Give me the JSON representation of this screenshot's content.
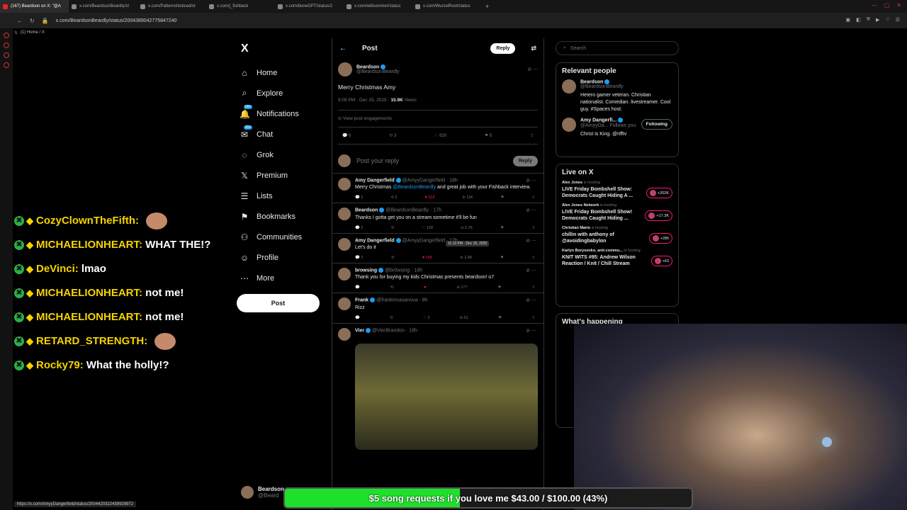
{
  "browser": {
    "tabs": [
      {
        "label": "(167) Beardson on X: \"@A",
        "active": true
      },
      {
        "label": "x.com/BeardsonBeardly/st",
        "active": false
      },
      {
        "label": "x.com/PatternsNoticed/st",
        "active": false
      },
      {
        "label": "x.com/j_fishback",
        "active": false
      },
      {
        "label": "x.com/boneGPT/status/2",
        "active": false
      },
      {
        "label": "x.com/willsommer/status",
        "active": false
      },
      {
        "label": "x.com/WurzelRoot/status",
        "active": false
      }
    ],
    "url": "x.com/BeardsonBeardly/status/2004389042775847240",
    "bookmark": "(1) Home / X",
    "status_url": "https://x.com/AmyyDangerfield/status/2004420322439929972"
  },
  "chat": [
    {
      "name": "CozyClownTheFifth:",
      "text": "",
      "emote": true
    },
    {
      "name": "MICHAELIONHEART:",
      "text": "WHAT THE!?",
      "emote": false
    },
    {
      "name": "DeVinci:",
      "text": "lmao",
      "emote": false
    },
    {
      "name": "MICHAELIONHEART:",
      "text": "not me!",
      "emote": false
    },
    {
      "name": "MICHAELIONHEART:",
      "text": "not me!",
      "emote": false
    },
    {
      "name": "RETARD_STRENGTH:",
      "text": "",
      "emote": true
    },
    {
      "name": "Rocky79:",
      "text": "What the holly!?",
      "emote": false
    }
  ],
  "xnav": {
    "logo": "X",
    "items": [
      {
        "label": "Home",
        "icon": "⌂",
        "badge": ""
      },
      {
        "label": "Explore",
        "icon": "⌕",
        "badge": ""
      },
      {
        "label": "Notifications",
        "icon": "🔔",
        "badge": "99+"
      },
      {
        "label": "Chat",
        "icon": "✉",
        "badge": "20+"
      },
      {
        "label": "Grok",
        "icon": "◌",
        "badge": ""
      },
      {
        "label": "Premium",
        "icon": "𝕏",
        "badge": ""
      },
      {
        "label": "Lists",
        "icon": "☰",
        "badge": ""
      },
      {
        "label": "Bookmarks",
        "icon": "⚑",
        "badge": ""
      },
      {
        "label": "Communities",
        "icon": "⚇",
        "badge": ""
      },
      {
        "label": "Profile",
        "icon": "☺",
        "badge": ""
      },
      {
        "label": "More",
        "icon": "⋯",
        "badge": ""
      }
    ],
    "post_label": "Post",
    "account_name": "Beardson",
    "account_handle": "@Beard"
  },
  "main": {
    "title": "Post",
    "reply_label": "Reply",
    "op": {
      "name": "Beardson",
      "handle": "@BeardsonBeardly",
      "text": "Merry Christmas Amy",
      "meta": "9:09 PM · Dec 25, 2025 · ",
      "views": "15.9K",
      "views_label": " Views",
      "engagements": "View post engagements",
      "replies": "6",
      "reposts": "3",
      "likes": "630",
      "bookmarks": "5"
    },
    "compose_placeholder": "Post your reply",
    "compose_button": "Reply",
    "replies": [
      {
        "name": "Amy Dangerfield",
        "handle": "@AmyyDangerfield · 18h",
        "text": "Merry Christmas ",
        "mention": "@BeardsonBeardly",
        "text2": " and great job with your Fishback interview.",
        "replies": "2",
        "reposts": "2",
        "likes": "312",
        "views": "11K",
        "liked": true
      },
      {
        "name": "Beardson",
        "handle": "@BeardsonBeardly · 17h",
        "text": "Thanks I gotta get you on a stream sometime it'll be fun",
        "mention": "",
        "text2": "",
        "replies": "2",
        "reposts": "",
        "likes": "128",
        "views": "2.7K",
        "liked": false
      },
      {
        "name": "Amy Dangerfield",
        "handle": "@AmyyDangerfield · 17h",
        "text": "Let's do it",
        "mention": "",
        "text2": "",
        "replies": "2",
        "reposts": "",
        "likes": "165",
        "views": "2.4K",
        "liked": true,
        "tooltip": "11:13 PM · Dec 25, 2025"
      },
      {
        "name": "browsing",
        "handle": "@br0wsing · 18h",
        "text": "Thank you for buying my kids Christmas presents beardson! o7",
        "mention": "",
        "text2": "",
        "replies": "",
        "reposts": "",
        "likes": "",
        "views": "177",
        "liked": true
      },
      {
        "name": "Frank",
        "handle": "@frankmcasanova · 8h",
        "text": "Rizz",
        "mention": "",
        "text2": "",
        "replies": "",
        "reposts": "",
        "likes": "2",
        "views": "51",
        "liked": false
      }
    ],
    "media_reply": {
      "name": "Vier",
      "handle": "@VierBrandon · 18h"
    }
  },
  "right": {
    "search_placeholder": "Search",
    "relevant_title": "Relevant people",
    "people": [
      {
        "name": "Beardson",
        "handle": "@BeardsonBeardly",
        "bio": "Hetero gamer veteran. Christian nationalist. Comedian. livestreamer. Cool guy. #Spaces host.",
        "follow": ""
      },
      {
        "name": "Amy Dangerfi...",
        "handle": "@AmyyDa... Follows you",
        "bio": "Christ is King. @rifftv",
        "follow": "Following"
      }
    ],
    "live_title": "Live on X",
    "live": [
      {
        "host": "Alex Jones",
        "status": " is hosting",
        "title": "LIVE Friday Bombshell Show: Democrats Caught Hiding A ...",
        "count": "+202K"
      },
      {
        "host": "Alex Jones Network",
        "status": " is hosting",
        "title": "LIVE Friday Bombshell Show! Democrats Caught Hiding ...",
        "count": "+17.3K"
      },
      {
        "host": "Christian Mario",
        "status": " is hosting",
        "title": "chillin with anthony of @avoidingbabylon",
        "count": "+285"
      },
      {
        "host": "Karlyn Borysenko, anti-commu...",
        "status": " is hosting",
        "title": "KNIT WITS #95: Andrew Wilson Reaction / Knit / Chill Stream",
        "count": "+63"
      }
    ],
    "happening_title": "What's happening"
  },
  "song": {
    "text": "$5 song requests if you love me $43.00 / $100.00 (43%)",
    "progress": 0.43,
    "color": "#1ee02a"
  }
}
